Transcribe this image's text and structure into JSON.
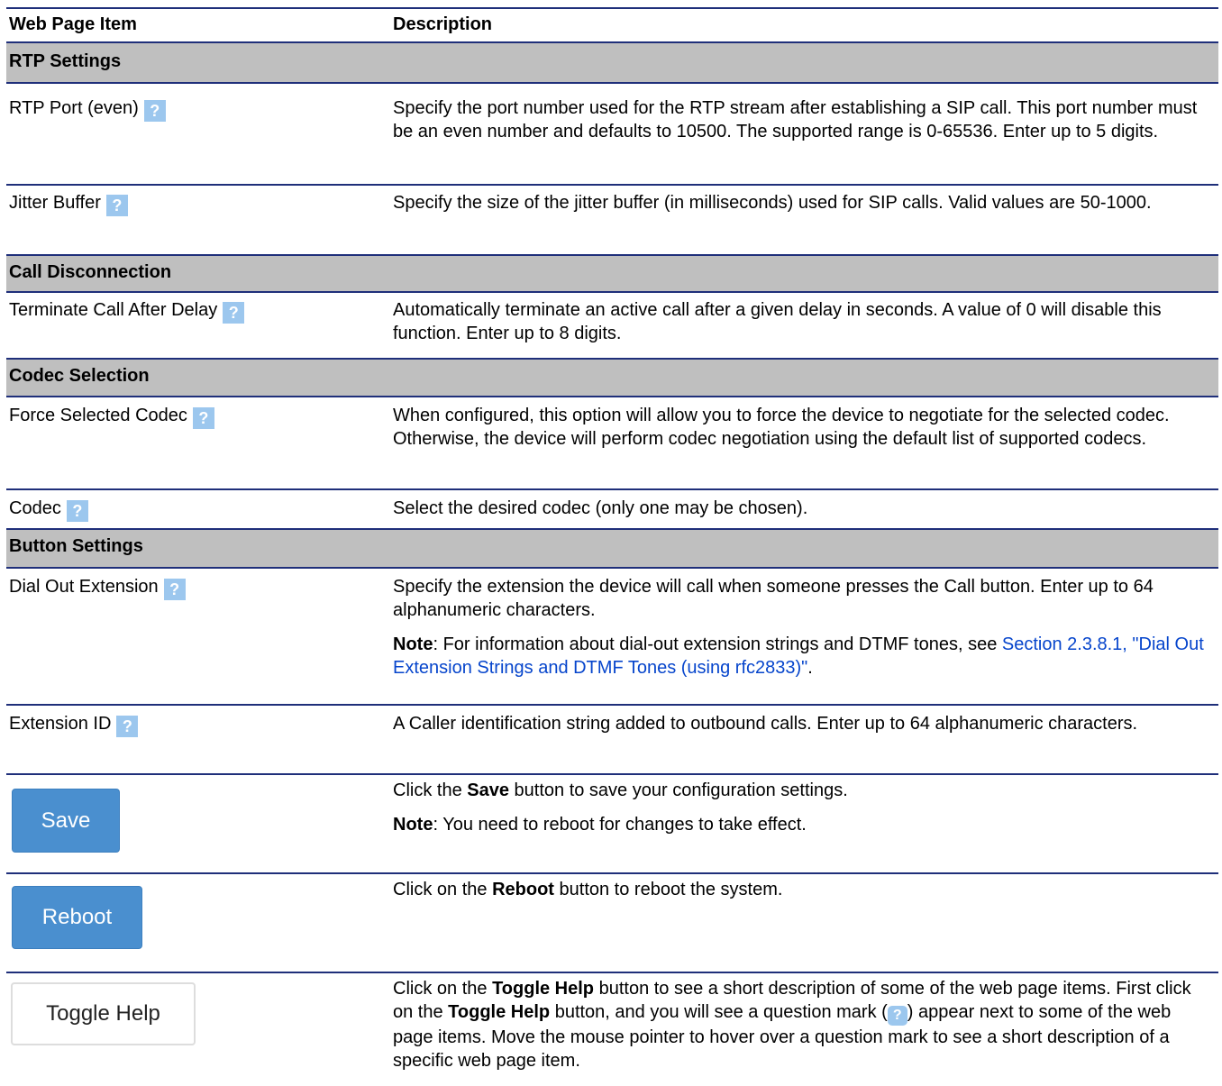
{
  "header": {
    "col1": "Web Page Item",
    "col2": "Description"
  },
  "sections": {
    "rtp": {
      "title": "RTP Settings",
      "port_label": "RTP Port (even)",
      "port_desc": "Specify the port number used for the RTP stream after establishing a SIP call. This port number must be an even number and defaults to 10500. The supported range is 0-65536. Enter up to 5 digits.",
      "jitter_label": "Jitter Buffer",
      "jitter_desc": "Specify the size of the jitter buffer (in milliseconds) used for SIP calls. Valid values are 50-1000."
    },
    "disconnect": {
      "title": "Call Disconnection",
      "terminate_label": "Terminate Call After Delay",
      "terminate_desc": "Automatically terminate an active call after a given delay in seconds. A value of 0 will disable this function. Enter up to 8 digits."
    },
    "codec": {
      "title": "Codec Selection",
      "force_label": "Force Selected Codec",
      "force_desc": "When configured, this option will allow you to force the device to negotiate for the selected codec. Otherwise, the device will perform codec negotiation using the default list of supported codecs.",
      "codec_label": "Codec",
      "codec_desc": "Select the desired codec (only one may be chosen)."
    },
    "button": {
      "title": "Button Settings",
      "dial_label": "Dial Out Extension",
      "dial_desc": "Specify the extension the device will call when someone presses the Call button. Enter up to 64 alphanumeric characters.",
      "dial_note_bold": "Note",
      "dial_note_text": ": For information about dial-out extension strings and DTMF tones, see ",
      "dial_note_link": "Section 2.3.8.1, \"Dial Out Extension Strings and DTMF Tones (using rfc2833)\"",
      "dial_note_end": ".",
      "ext_label": "Extension ID",
      "ext_desc": "A Caller identification string added to outbound calls. Enter up to 64 alphanumeric characters."
    }
  },
  "help_icon_glyph": "?",
  "actions": {
    "save": {
      "button_label": "Save",
      "desc_pre": "Click the ",
      "desc_bold": "Save",
      "desc_post": " button to save your configuration settings.",
      "note_bold": "Note",
      "note_text": ": You need to reboot for changes to take effect."
    },
    "reboot": {
      "button_label": "Reboot",
      "desc_pre": "Click on the ",
      "desc_bold": "Reboot",
      "desc_post": " button to reboot the system."
    },
    "toggle": {
      "button_label": "Toggle Help",
      "t1": "Click on the ",
      "b1": "Toggle Help",
      "t2": " button to see a short description of some of the web page items. First click on the ",
      "b2": "Toggle Help",
      "t3": " button, and you will see a question mark (",
      "t4": ") appear next to some of the web page items. Move the mouse pointer to hover over a question mark to see a short description of a specific web page item."
    }
  },
  "colors": {
    "rule": "#1f2f7a",
    "section_bg": "#bfbfbf",
    "primary": "#4a8fcf",
    "help_icon": "#9cc7ee",
    "link": "#0645cc"
  }
}
